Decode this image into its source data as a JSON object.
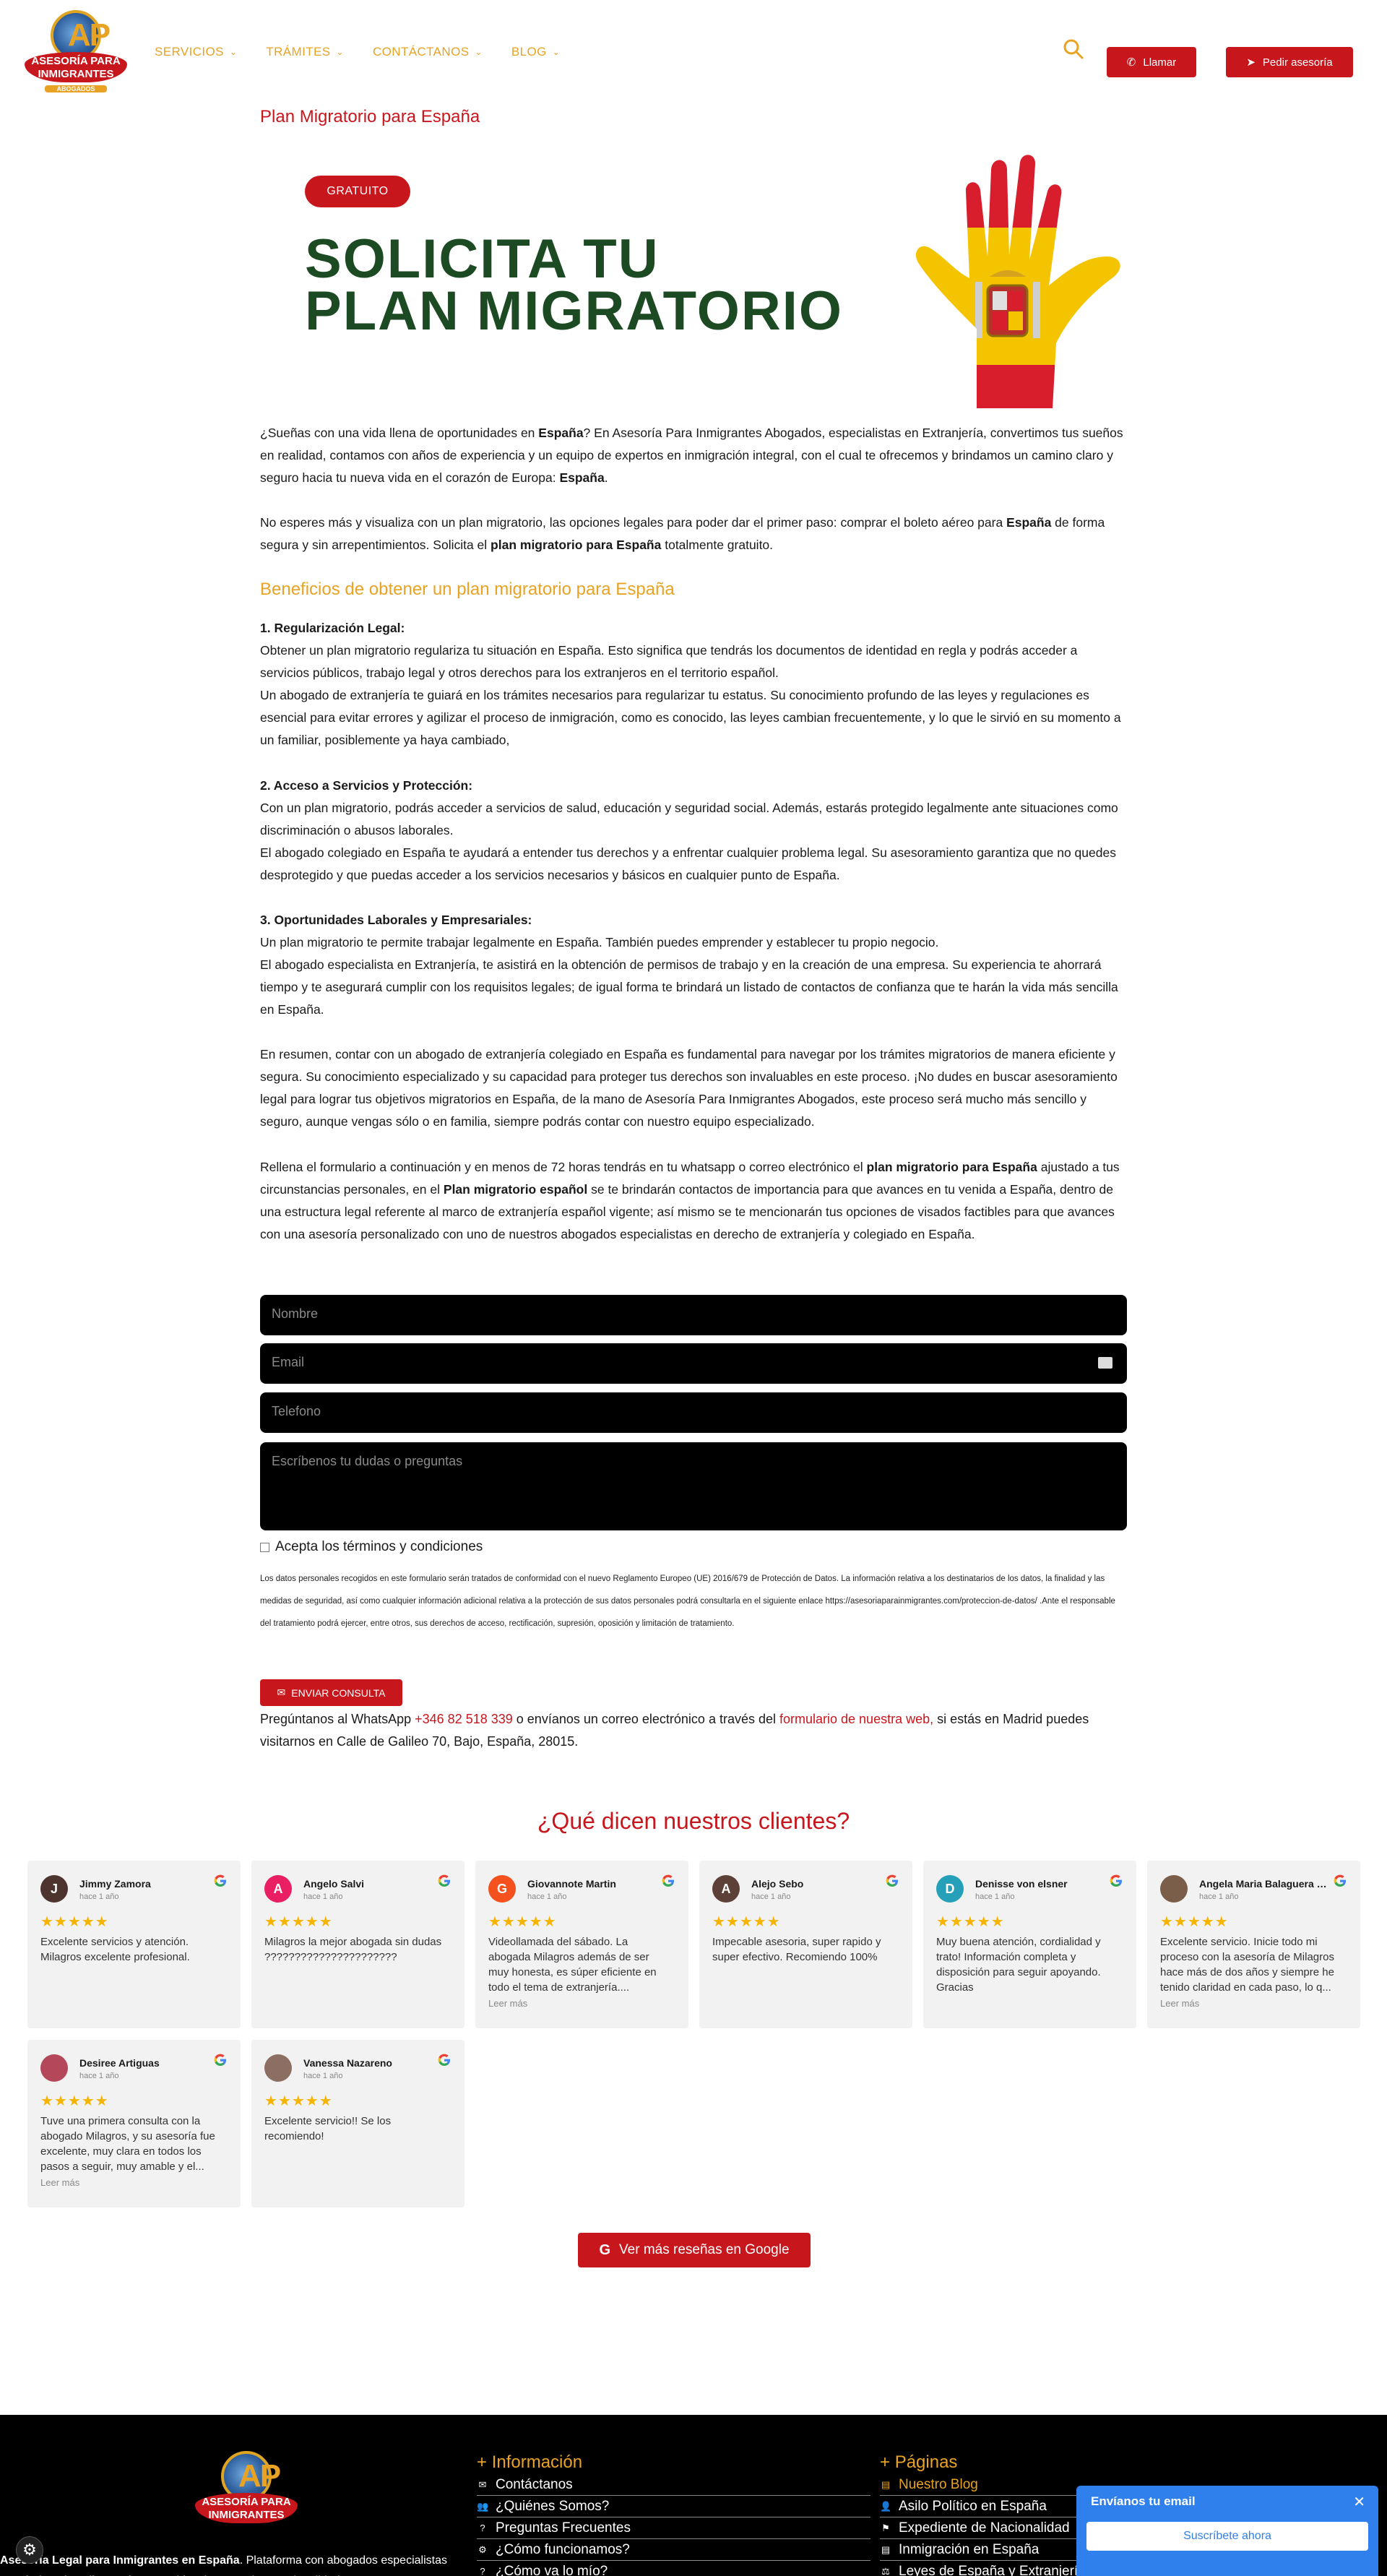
{
  "brand": {
    "logo_letters": "AP",
    "logo_line1": "ASESORÍA PARA",
    "logo_line2": "INMIGRANTES",
    "logo_sub": "ABOGADOS",
    "red": "#c8161d",
    "gold": "#e8a325",
    "green": "#1c4a23"
  },
  "nav": {
    "items": [
      {
        "label": "SERVICIOS"
      },
      {
        "label": "TRÁMITES"
      },
      {
        "label": "CONTÁCTANOS"
      },
      {
        "label": "BLOG"
      }
    ],
    "call_label": "Llamar",
    "advice_label": "Pedir asesoría"
  },
  "page_title": "Plan Migratorio para España",
  "hero": {
    "badge": "GRATUITO",
    "title_line1": "SOLICITA TU",
    "title_line2": "PLAN MIGRATORIO"
  },
  "intro": {
    "p1_a": "¿Sueñas con una vida llena de oportunidades en ",
    "p1_b": "España",
    "p1_c": "? En Asesoría Para Inmigrantes Abogados, especialistas en Extranjería, convertimos tus sueños en realidad, contamos con años de experiencia y un equipo de expertos en inmigración integral, con el cual te ofrecemos y brindamos  un camino claro y seguro hacia tu nueva vida en el corazón de Europa: ",
    "p1_d": "España",
    "p1_e": ".",
    "p2_a": "No esperes más y visualiza con un plan migratorio, las opciones legales para poder dar el primer paso: comprar el boleto aéreo para ",
    "p2_b": "España",
    "p2_c": " de forma segura y sin arrepentimientos. Solicita el ",
    "p2_d": "plan migratorio para España",
    "p2_e": " totalmente gratuito."
  },
  "benefits": {
    "heading": "Beneficios de obtener un plan migratorio para España",
    "b1_title": "1. Regularización Legal:",
    "b1_text": "Obtener un plan migratorio regulariza tu situación en España. Esto significa que tendrás los documentos de identidad en regla y podrás acceder a servicios públicos, trabajo legal y otros derechos para los extranjeros en el territorio español.",
    "b1_text2": "Un abogado de extranjería te guiará en los trámites necesarios para regularizar tu estatus. Su conocimiento profundo de las leyes y regulaciones es esencial para evitar errores y agilizar el proceso de inmigración, como es conocido, las leyes cambian frecuentemente, y lo que le sirvió en su momento a un familiar, posiblemente ya haya cambiado,",
    "b2_title": "2. Acceso a Servicios y Protección:",
    "b2_text": "Con un plan migratorio, podrás acceder a servicios de salud, educación y seguridad social. Además, estarás protegido legalmente ante situaciones como discriminación o abusos laborales.",
    "b2_text2": "El abogado colegiado en España te ayudará a entender tus derechos y a enfrentar cualquier problema legal. Su asesoramiento garantiza que no quedes desprotegido y que puedas acceder a los servicios necesarios y básicos en cualquier punto de España.",
    "b3_title": "3. Oportunidades Laborales y Empresariales:",
    "b3_text": "Un plan migratorio te permite trabajar legalmente en España. También puedes emprender y establecer tu propio negocio.",
    "b3_text2": "El abogado especialista en Extranjería, te asistirá en la obtención de permisos de trabajo y en la creación de una empresa. Su experiencia te ahorrará tiempo y te asegurará cumplir con los requisitos legales; de igual forma te brindará un listado de contactos de confianza que te harán la vida más sencilla en España.",
    "summary": "En resumen, contar con un abogado de extranjería colegiado en España es fundamental para navegar por los trámites migratorios de manera eficiente y segura. Su conocimiento especializado y su capacidad para proteger tus derechos son invaluables en este proceso. ¡No dudes en buscar asesoramiento legal para lograr tus objetivos migratorios en España, de la mano de Asesoría Para Inmigrantes Abogados, este proceso será mucho más sencillo y seguro, aunque vengas sólo o en familia, siempre podrás contar con nuestro equipo especializado.",
    "cta_a": "Rellena el formulario a continuación y en menos de 72 horas tendrás en tu whatsapp o correo electrónico el ",
    "cta_b": "plan migratorio para España",
    "cta_c": " ajustado a tus circunstancias personales, en el ",
    "cta_d": "Plan migratorio español",
    "cta_e": " se te brindarán contactos de importancia para que avances en tu venida a España, dentro de una estructura legal referente al marco de extranjería español vigente; así mismo se te mencionarán tus opciones de visados factibles para que avances con una asesoría personalizado con uno de nuestros abogados especialistas en derecho de extranjería y colegiado en España."
  },
  "form": {
    "name_ph": "Nombre",
    "email_ph": "Email",
    "phone_ph": "Telefono",
    "message_ph": "Escríbenos tu dudas o preguntas",
    "terms_label": "Acepta los términos y condiciones",
    "legal_text": "Los datos personales recogidos en este formulario serán tratados de conformidad con el nuevo Reglamento Europeo (UE) 2016/679 de Protección de Datos. La información relativa a los destinatarios de los datos, la finalidad y las medidas de seguridad, así como cualquier información adicional relativa a la protección de sus datos personales podrá consultarla en el siguiente enlace https://asesoriaparainmigrantes.com/proteccion-de-datos/ .Ante el responsable del tratamiento podrá ejercer, entre otros, sus derechos de acceso, rectificación, supresión, oposición y limitación de tratamiento.",
    "submit_label": "ENVIAR CONSULTA"
  },
  "contact": {
    "a": "Pregúntanos al WhatsApp ",
    "phone": "+346 82 518 339",
    "b": " o envíanos un correo electrónico a través del ",
    "link": "formulario de nuestra web,",
    "c": " si estás en Madrid puedes visitarnos en Calle de Galileo 70, Bajo, España, 28015."
  },
  "reviews": {
    "title": "¿Qué dicen nuestros clientes?",
    "stars": "★★★★★",
    "more_label": "Leer más",
    "google_button": "Ver más reseñas en Google",
    "items": [
      {
        "name": "Jimmy Zamora",
        "initial": "J",
        "color": "#4e342e",
        "ago": "hace 1 año",
        "text": "Excelente servicios y atención. Milagros excelente profesional."
      },
      {
        "name": "Angelo Salvi",
        "initial": "A",
        "color": "#e91e63",
        "ago": "hace 1 año",
        "text": "Milagros la mejor abogada sin dudas ??????????????????????"
      },
      {
        "name": "Giovannote Martin",
        "initial": "G",
        "color": "#f4511e",
        "ago": "hace 1 año",
        "text": "Videollamada del sábado. La abogada Milagros además de ser muy honesta, es súper eficiente en todo el tema de extranjería....",
        "more": true
      },
      {
        "name": "Alejo Sebo",
        "initial": "A",
        "color": "#5d4037",
        "ago": "hace 1 año",
        "text": "Impecable asesoria, super rapido y super efectivo. Recomiendo 100%"
      },
      {
        "name": "Denisse von elsner",
        "initial": "D",
        "color": "#26a0b8",
        "ago": "hace 1 año",
        "text": "Muy buena atención, cordialidad y trato! Información completa y disposición para seguir apoyando. Gracias"
      },
      {
        "name": "Angela Maria Balaguera Díaz",
        "initial": "",
        "color": "#7b5e4a",
        "ago": "hace 1 año",
        "text": "Excelente servicio. Inicie todo mi proceso con la asesoría de Milagros hace más de dos años y siempre he tenido claridad en cada paso, lo q...",
        "more": true
      },
      {
        "name": "Desiree Artiguas",
        "initial": "",
        "color": "#b5475a",
        "ago": "hace 1 año",
        "text": "Tuve una primera consulta con la abogado Milagros, y su asesoría fue excelente, muy clara en todos los pasos a seguir, muy amable y el...",
        "more": true
      },
      {
        "name": "Vanessa Nazareno",
        "initial": "",
        "color": "#8d6e63",
        "ago": "hace 1 año",
        "text": "Excelente servicio!! Se los recomiendo!"
      }
    ]
  },
  "footer": {
    "desc_bold": "Asesoría Legal para Inmigrantes en España",
    "desc_rest": ". Plataforma con abogados especialistas en trámites de Asilo, Arraigos, Residencia, Espacio y Nacionalidad",
    "info_title": "Información",
    "info_items": [
      {
        "label": "Contáctanos",
        "icon": "✉"
      },
      {
        "label": "¿Quiénes Somos?",
        "icon": "👥"
      },
      {
        "label": "Preguntas Frecuentes",
        "icon": "?"
      },
      {
        "label": "¿Cómo funcionamos?",
        "icon": "⚙"
      },
      {
        "label": "¿Cómo va lo mío?",
        "icon": "?"
      }
    ],
    "pages_title": "Páginas",
    "pages_items": [
      {
        "label": "Nuestro Blog",
        "icon": "▤",
        "highlight": true
      },
      {
        "label": "Asilo Político en España",
        "icon": "👤"
      },
      {
        "label": "Expediente de Nacionalidad",
        "icon": "⚑"
      },
      {
        "label": "Inmigración en España",
        "icon": "▤"
      },
      {
        "label": "Leyes de España y Extranjería",
        "icon": "⚖"
      }
    ]
  },
  "popup": {
    "title": "Envíanos tu email",
    "button": "Suscríbete ahora"
  }
}
